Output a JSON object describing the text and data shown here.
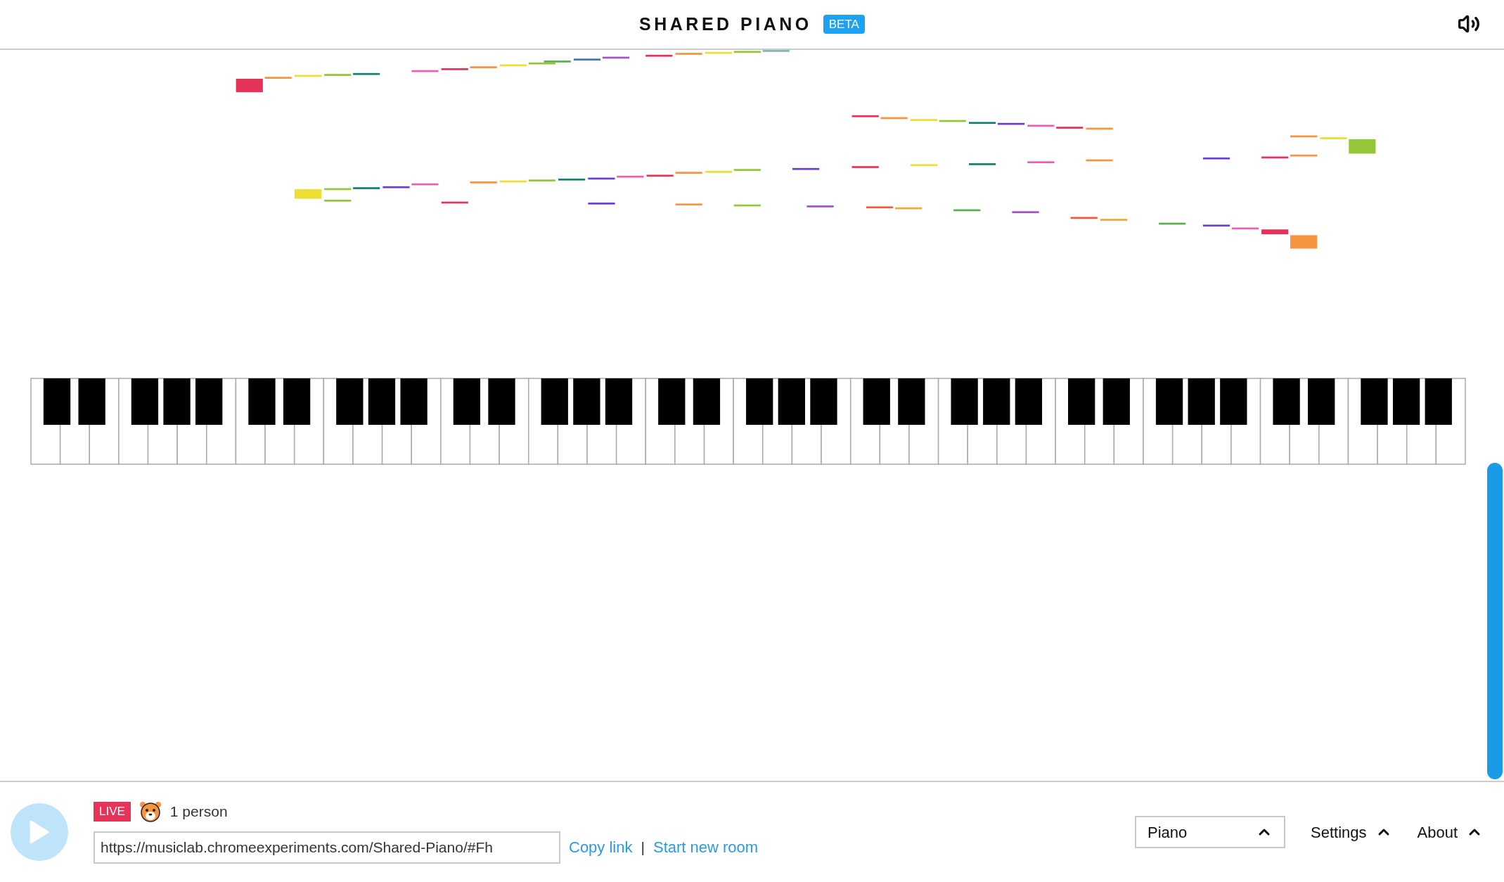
{
  "header": {
    "title": "SHARED PIANO",
    "badge": "BETA"
  },
  "footer": {
    "live_badge": "LIVE",
    "people": "1 person",
    "room_url": "https://musiclab.chromeexperiments.com/Shared-Piano/#Fh",
    "links": [
      {
        "label": "Copy link"
      },
      {
        "label": "Start new room"
      }
    ],
    "separator": "|",
    "instrument": {
      "value": "Piano"
    },
    "menus": [
      {
        "label": "Settings"
      },
      {
        "label": "About"
      }
    ]
  }
}
